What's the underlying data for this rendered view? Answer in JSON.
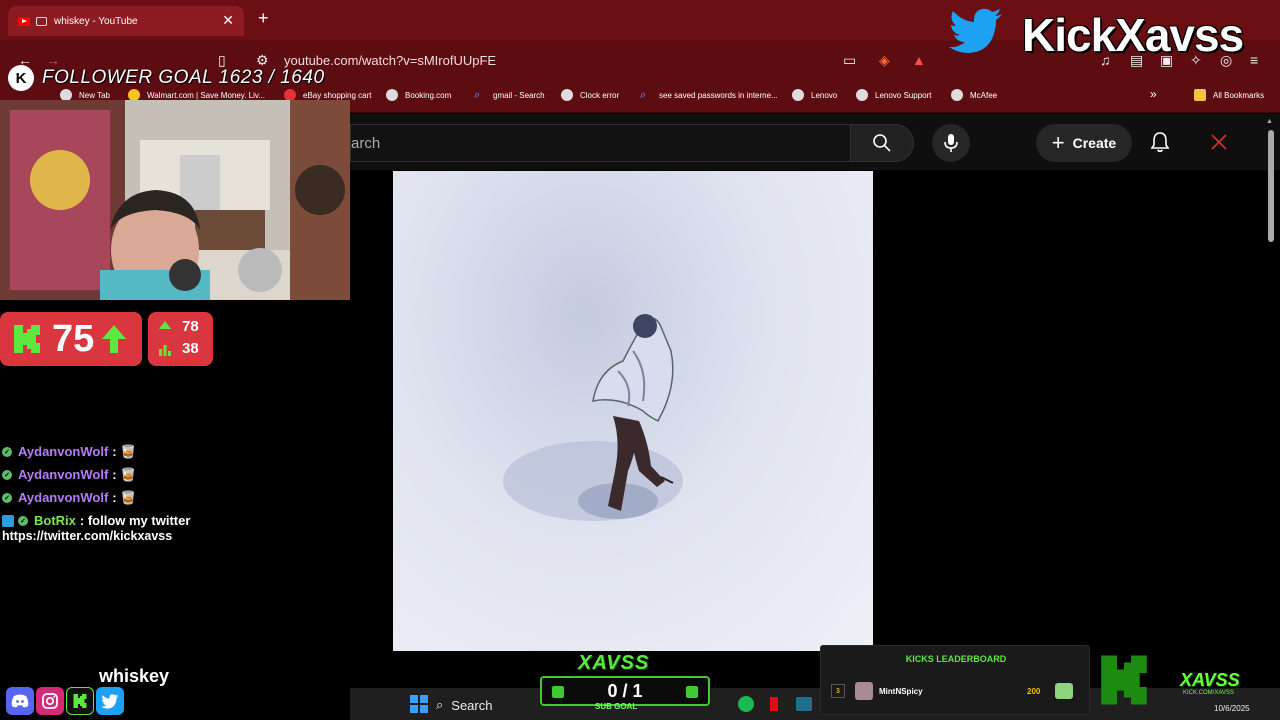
{
  "browser": {
    "tab_title": "whiskey - YouTube",
    "address": "youtube.com/watch?v=sMIrofUUpFE",
    "bookmarks": [
      "New Tab",
      "Walmart.com | Save Money. Liv...",
      "eBay shopping cart",
      "Booking.com",
      "gmail - Search",
      "Clock error",
      "see saved passwords in interne...",
      "Lenovo",
      "Lenovo Support",
      "McAfee"
    ],
    "all_bookmarks": "All Bookmarks"
  },
  "youtube": {
    "search_placeholder": "arch",
    "create_label": "Create"
  },
  "overlay": {
    "follower_goal": "FOLLOWER GOAL 1623 / 1640",
    "kick_count": "75",
    "stat_top": "78",
    "stat_bottom": "38",
    "brand": "KickXavss",
    "song_title": "whiskey",
    "sub_goal_value": "0 / 1",
    "sub_goal_label": "SUB GOAL",
    "xavss_logo": "XAVSS",
    "chat": [
      {
        "user": "AydanvonWolf",
        "text": ": 🥃"
      },
      {
        "user": "AydanvonWolf",
        "text": ": 🥃"
      },
      {
        "user": "AydanvonWolf",
        "text": ": 🥃"
      },
      {
        "user": "BotRix",
        "text": ": follow my twitter"
      }
    ],
    "chat_link": "https://twitter.com/kickxavss",
    "leaderboard": {
      "title": "KICKS LEADERBOARD",
      "rank": "3",
      "name": "MintNSpicy",
      "score": "200"
    },
    "corner_logo": "XAVSS",
    "corner_sub": "KICK.COM/XAVSS"
  },
  "taskbar": {
    "search_label": "Search",
    "date": "10/6/2025"
  },
  "colors": {
    "accent_red": "#d9363f",
    "kick_green": "#5ce840",
    "chrome_red": "#6b0f15"
  }
}
